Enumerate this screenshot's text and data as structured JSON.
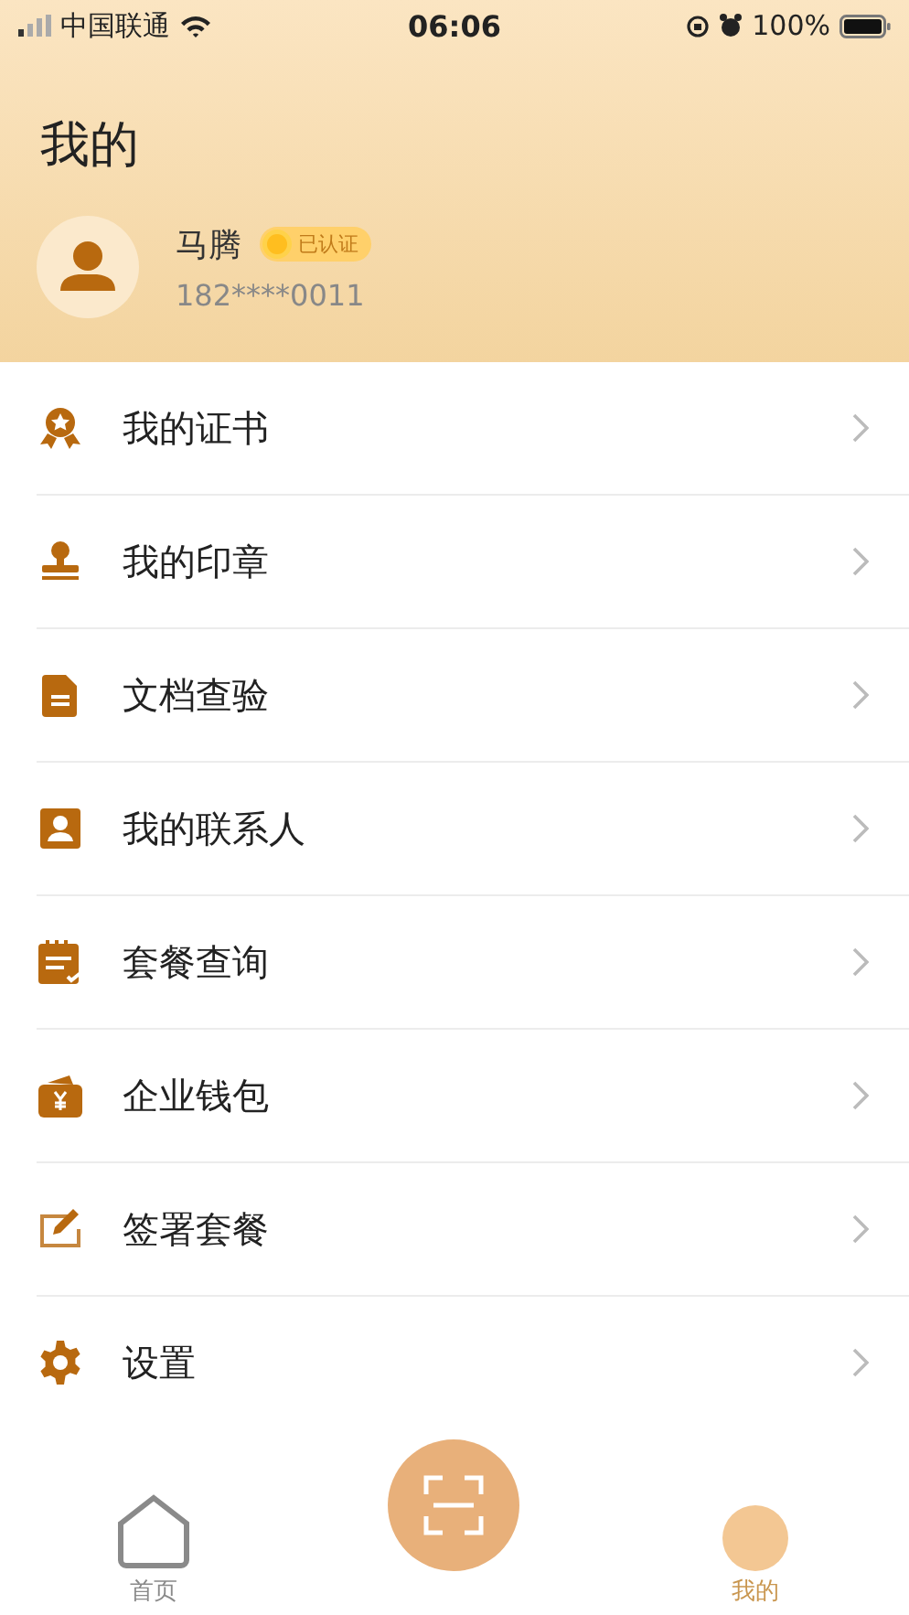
{
  "status_bar": {
    "carrier": "中国联通",
    "time": "06:06",
    "battery": "100%"
  },
  "header": {
    "title": "我的",
    "user": {
      "name": "马腾",
      "badge": "已认证",
      "phone": "182****0011"
    }
  },
  "menu": [
    {
      "kind": "certificate",
      "label": "我的证书"
    },
    {
      "kind": "stamp",
      "label": "我的印章"
    },
    {
      "kind": "document",
      "label": "文档查验"
    },
    {
      "kind": "contact",
      "label": "我的联系人"
    },
    {
      "kind": "plan",
      "label": "套餐查询"
    },
    {
      "kind": "wallet",
      "label": "企业钱包"
    },
    {
      "kind": "sign",
      "label": "签署套餐"
    },
    {
      "kind": "settings",
      "label": "设置"
    }
  ],
  "tab_bar": [
    {
      "kind": "home",
      "label": "首页",
      "selected": false
    },
    {
      "kind": "scan",
      "selected": false
    },
    {
      "kind": "me",
      "label": "我的",
      "selected": true
    }
  ]
}
